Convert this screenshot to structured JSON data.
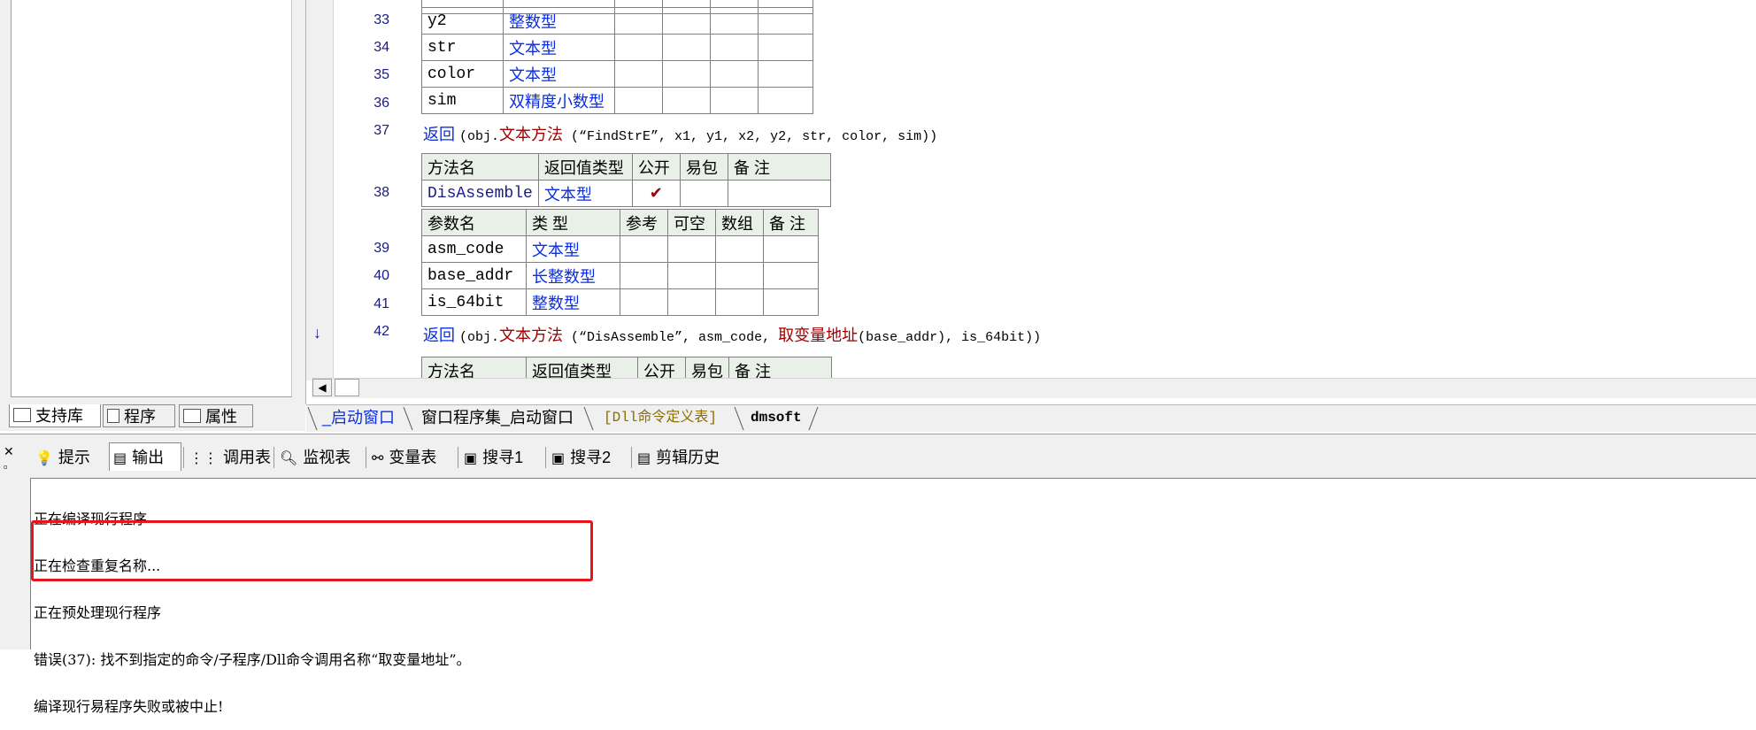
{
  "editor": {
    "lines": {
      "l33": {
        "num": "33",
        "name": "y2",
        "type": "整数型"
      },
      "l34": {
        "num": "34",
        "name": "str",
        "type": "文本型"
      },
      "l35": {
        "num": "35",
        "name": "color",
        "type": "文本型"
      },
      "l36": {
        "num": "36",
        "name": "sim",
        "type": "双精度小数型"
      },
      "l37": {
        "num": "37",
        "kw": "返回",
        "open": "(obj.",
        "method": "文本方法",
        "args": " (“FindStrE”, x1, y1, x2, y2, str, color, sim))"
      },
      "l38": {
        "num": "38"
      },
      "l39": {
        "num": "39",
        "name": "asm_code",
        "type": "文本型"
      },
      "l40": {
        "num": "40",
        "name": "base_addr",
        "type": "长整数型"
      },
      "l41": {
        "num": "41",
        "name": "is_64bit",
        "type": "整数型"
      },
      "l42": {
        "num": "42",
        "kw": "返回",
        "open": "(obj.",
        "method": "文本方法",
        "args1": " (“DisAssemble”, asm_code, ",
        "call": "取变量地址",
        "args2": "(base_addr), is_64bit))"
      }
    },
    "method_header": {
      "c1": "方法名",
      "c2": "返回值类型",
      "c3": "公开",
      "c4": "易包",
      "c5": "备 注"
    },
    "method_row": {
      "name": "DisAssemble",
      "ret": "文本型",
      "public": "✔"
    },
    "param_header": {
      "c1": "参数名",
      "c2": "类 型",
      "c3": "参考",
      "c4": "可空",
      "c5": "数组",
      "c6": "备 注"
    },
    "next_header": {
      "c1": "方法名",
      "c2": "返回值类型",
      "c3": "公开",
      "c4": "易包",
      "c5": "备 注"
    }
  },
  "left_tabs": {
    "support": "支持库",
    "program": "程序",
    "property": "属性"
  },
  "editor_tabs": {
    "t1": "_启动窗口",
    "t2": "窗口程序集_启动窗口",
    "t3": "[Dll命令定义表]",
    "t4": "dmsoft"
  },
  "output_tabs": {
    "hint": "提示",
    "output": "输出",
    "calltable": "调用表",
    "watch": "监视表",
    "vartable": "变量表",
    "search1": "搜寻1",
    "search2": "搜寻2",
    "clip": "剪辑历史"
  },
  "output_lines": {
    "l1": "正在编译现行程序",
    "l2": "正在检查重复名称...",
    "l3": "正在预处理现行程序",
    "l4": "错误(37): 找不到指定的命令/子程序/Dll命令调用名称“取变量地址”。",
    "l5": "编译现行易程序失败或被中止!"
  },
  "colors": {
    "keyword": "#0b2ee0",
    "method": "#a00000",
    "highlight": "#e8141c"
  }
}
